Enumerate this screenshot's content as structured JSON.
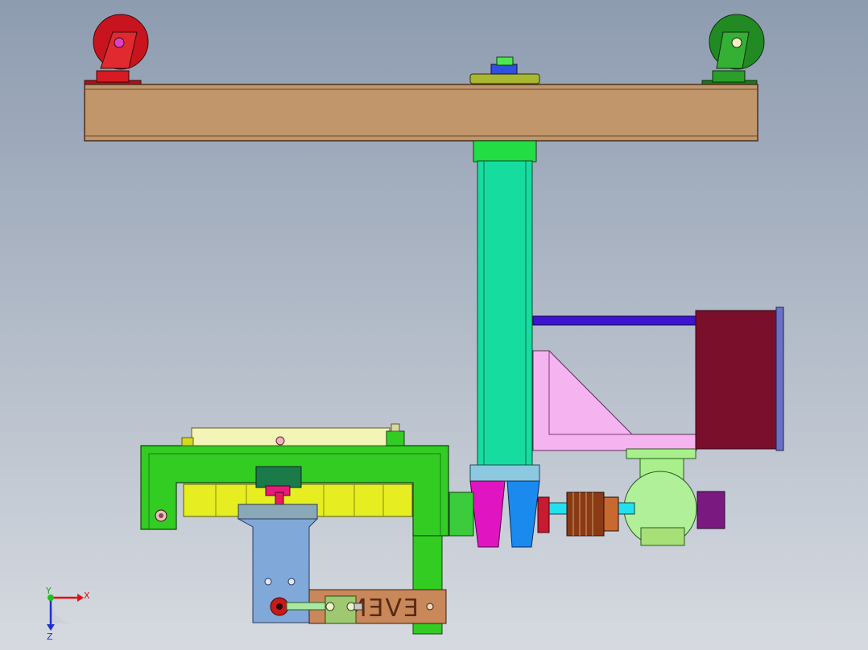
{
  "viewport": {
    "background_top": "#8e9cb0",
    "background_bottom": "#d6dae0"
  },
  "model": {
    "engraved_plate_text": "EVEN",
    "colors": {
      "beam": "#c0966a",
      "left_caster": "#c8141e",
      "right_caster": "#228a22",
      "column": "#16dca0",
      "column_cap": "#22dd44",
      "tie_rod": "#3c14d2",
      "motor": "#7a0f2c",
      "bracket": "#f5b4f0",
      "gripper_frame": "#33cc22",
      "rollers": "#e6ee22",
      "mount_plate": "#80a8d8",
      "nameplate": "#c8885a",
      "coupling": "#8a3a14"
    }
  },
  "triad": {
    "x_label": "X",
    "y_label": "Y",
    "z_label": "Z"
  }
}
